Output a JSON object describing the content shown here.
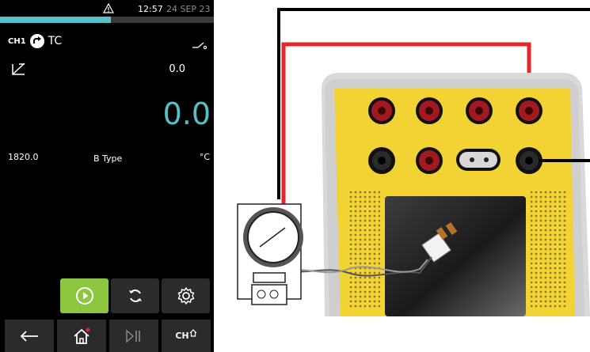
{
  "status": {
    "time": "12:57",
    "date": "24 SEP 23",
    "progress": 0.52,
    "warning_icon": "warning-triangle-icon"
  },
  "channel": {
    "label": "CH1",
    "mode_icon": "source-arrow-icon",
    "type": "TC",
    "link_icon": "link-switch-icon"
  },
  "readings": {
    "aux_value": "0.0",
    "main_value": "0.0",
    "range_max": "1820.0",
    "type_name": "B Type",
    "unit": "°C"
  },
  "controls": {
    "play": "play-circle-icon",
    "refresh": "refresh-icon",
    "settings": "gear-icon"
  },
  "nav": {
    "back": "back-arrow-icon",
    "home": "home-icon",
    "playpause": "play-pause-icon",
    "ch_label": "CH"
  },
  "colors": {
    "accent": "#53c2c8",
    "play_button": "#8dc63f",
    "device_body": "#f2d333",
    "wire_red": "#e5262a",
    "wire_black": "#000000"
  }
}
